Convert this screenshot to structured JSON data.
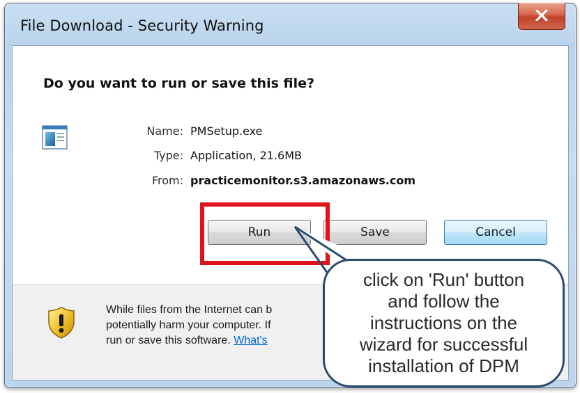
{
  "window": {
    "title": "File Download - Security Warning",
    "close_icon": "close-x-icon"
  },
  "dialog": {
    "question": "Do you want to run or save this file?",
    "file_icon": "application-file-icon",
    "name_label": "Name:",
    "name_value": "PMSetup.exe",
    "type_label": "Type:",
    "type_value": "Application, 21.6MB",
    "from_label": "From:",
    "from_value": "practicemonitor.s3.amazonaws.com"
  },
  "buttons": {
    "run": "Run",
    "save": "Save",
    "cancel": "Cancel"
  },
  "warning": {
    "icon": "shield-warning-icon",
    "line1": "While files from the Internet can b",
    "line2": "potentially harm your computer. If",
    "line3_prefix": "run or save this software. ",
    "link": "What's"
  },
  "callout": {
    "text": "click  on 'Run' button\nand follow the\ninstructions on the\nwizard for successful\ninstallation of DPM"
  },
  "colors": {
    "highlight_border": "#e0121b",
    "callout_border": "#2d4a6e",
    "link": "#0066cc",
    "close_button": "#c2412a"
  }
}
